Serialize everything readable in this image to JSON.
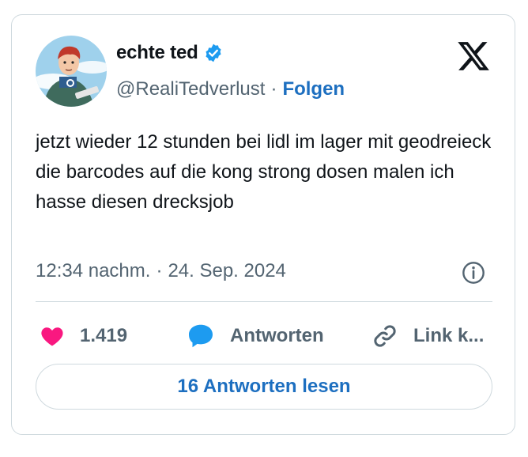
{
  "author": {
    "display_name": "echte ted",
    "handle": "@RealiTedverlust",
    "separator": "·",
    "follow_label": "Folgen"
  },
  "tweet": {
    "text": "jetzt wieder 12 stunden bei lidl im lager mit geodreieck die barcodes auf die kong strong dosen malen ich hasse diesen drecksjob",
    "time": "12:34 nachm.",
    "separator": "·",
    "date": "24. Sep. 2024"
  },
  "actions": {
    "like_count": "1.419",
    "reply_label": "Antworten",
    "copy_link_label": "Link k..."
  },
  "read_replies_label": "16 Antworten lesen",
  "icons": {
    "verified": "verified-badge-icon",
    "brand": "x-logo-icon",
    "info": "info-icon",
    "like": "heart-icon",
    "reply": "speech-bubble-icon",
    "link": "link-icon"
  },
  "colors": {
    "accent": "#1d6fc0",
    "verified": "#1d9bf0",
    "heart": "#f91880",
    "text": "#0f1419",
    "muted": "#536471",
    "border": "#cfd9de"
  }
}
